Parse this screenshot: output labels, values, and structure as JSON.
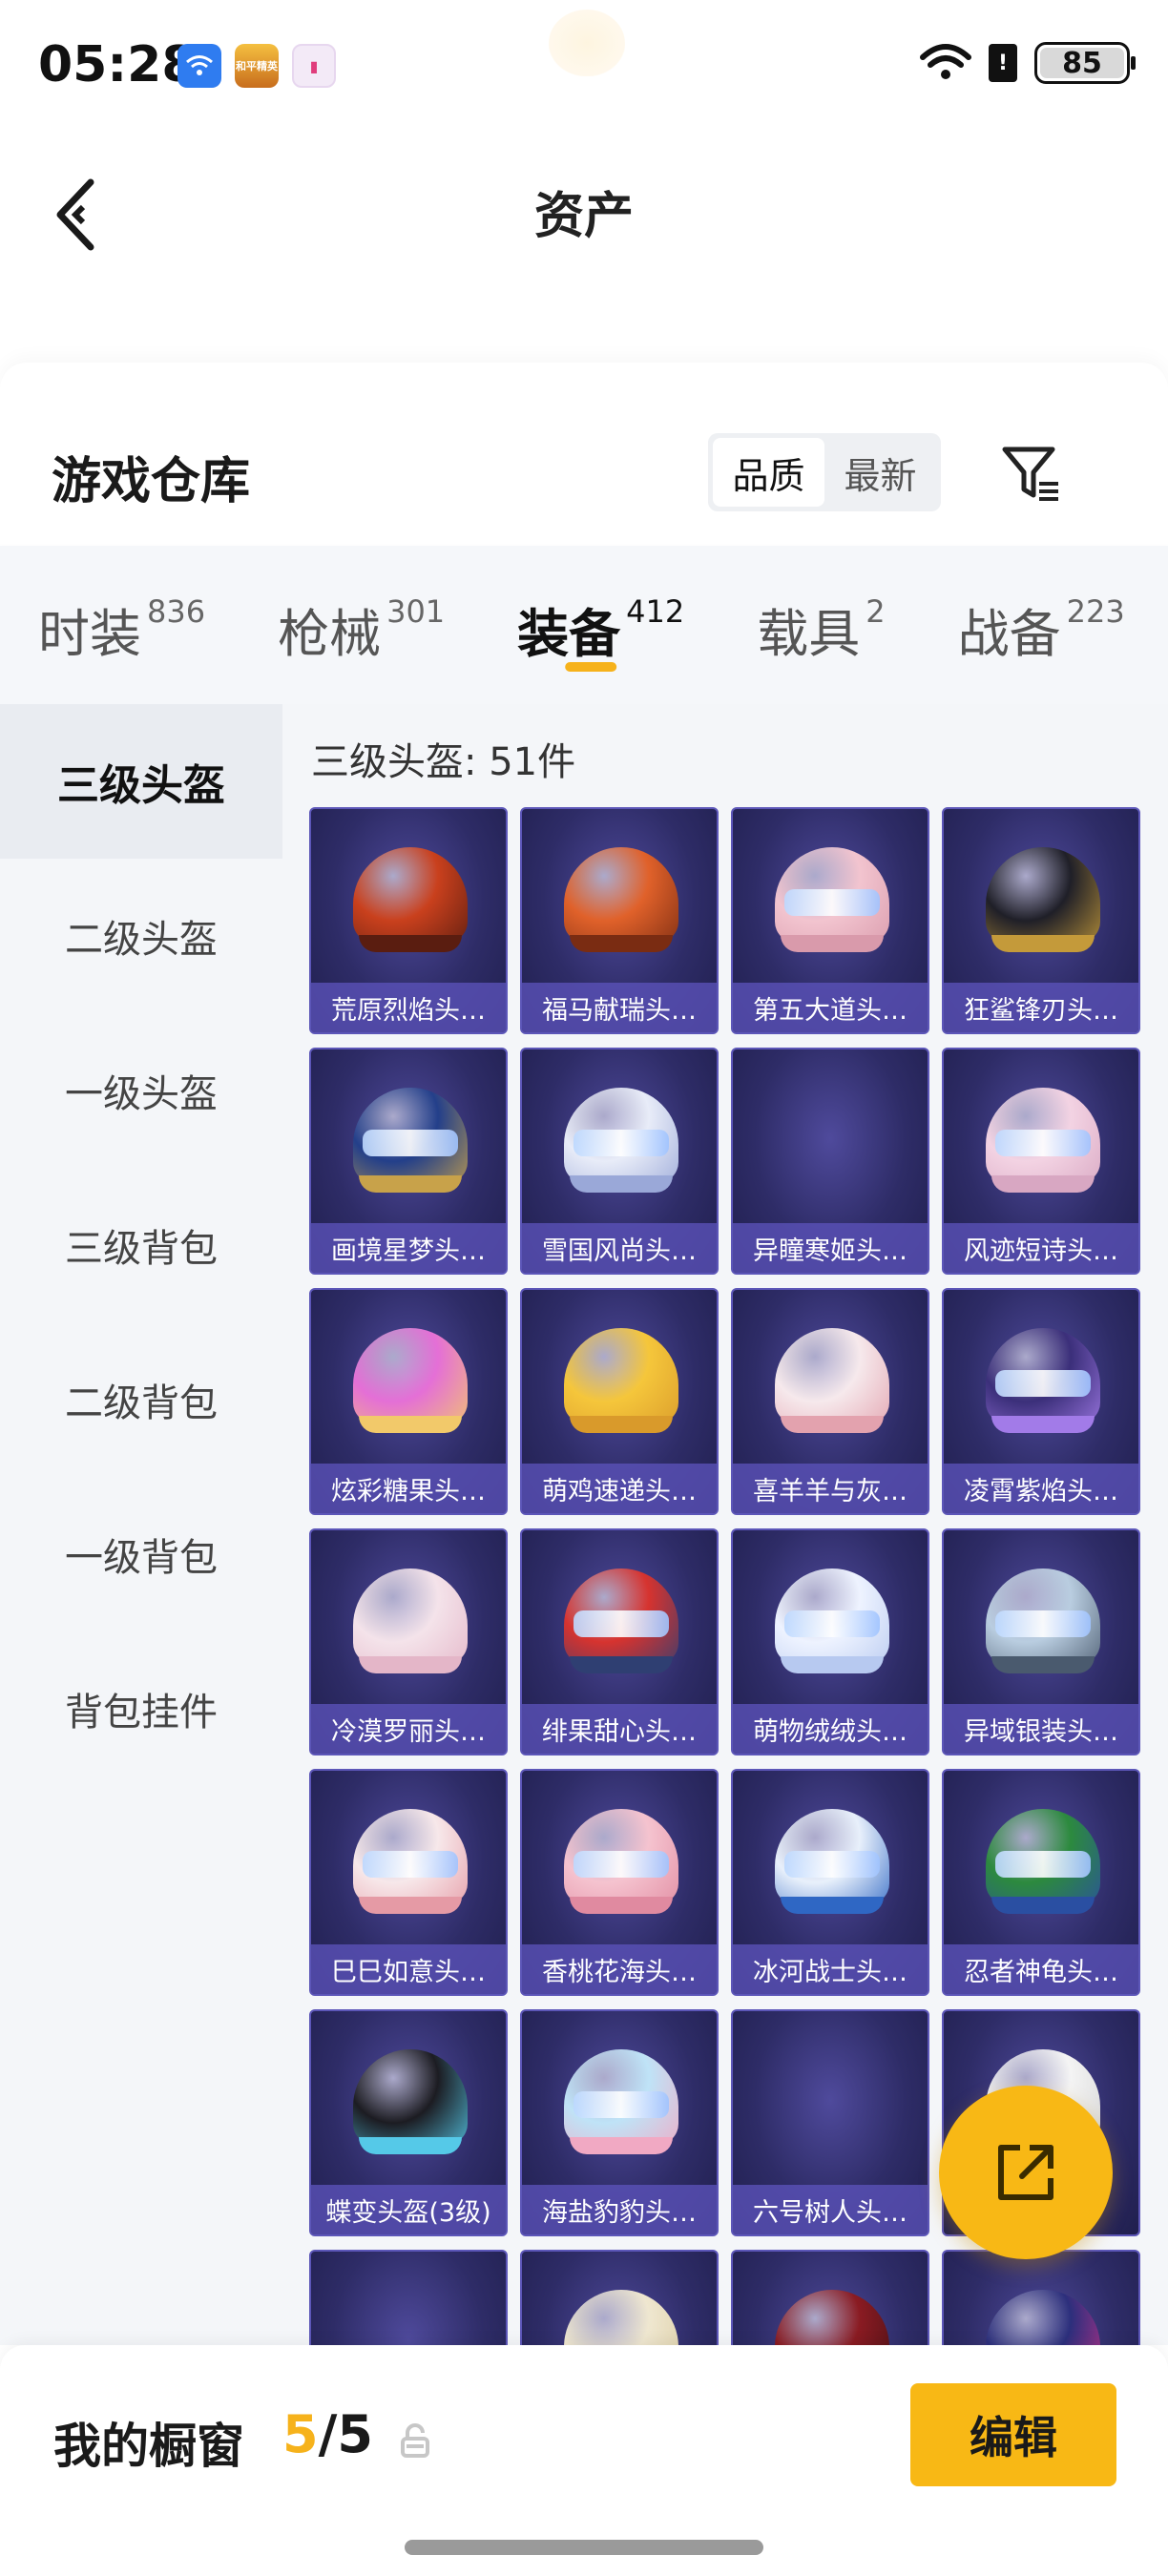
{
  "status_bar": {
    "time": "05:28",
    "battery": "85",
    "notification_icons": [
      "wifi-app-icon",
      "game-app-icon",
      "shop-app-icon"
    ],
    "game_app_icon_text": "和平精英"
  },
  "header": {
    "title": "资产"
  },
  "warehouse": {
    "title": "游戏仓库",
    "sort_options": [
      "品质",
      "最新"
    ],
    "selected_sort": "品质"
  },
  "tabs": [
    {
      "label": "时装",
      "count": "836"
    },
    {
      "label": "枪械",
      "count": "301"
    },
    {
      "label": "装备",
      "count": "412",
      "active": true
    },
    {
      "label": "载具",
      "count": "2"
    },
    {
      "label": "战备",
      "count": "223"
    }
  ],
  "sidebar": {
    "items": [
      "三级头盔",
      "二级头盔",
      "一级头盔",
      "三级背包",
      "二级背包",
      "一级背包",
      "背包挂件"
    ],
    "active": "三级头盔"
  },
  "section_title": "三级头盔: 51件",
  "items": [
    {
      "name": "荒原烈焰头…",
      "dome": "#c9401d",
      "rim": "#5a1d10",
      "visor": false
    },
    {
      "name": "福马献瑞头…",
      "dome": "#e0612a",
      "rim": "#7a2c12",
      "visor": false
    },
    {
      "name": "第五大道头…",
      "dome": "#f2c4cf",
      "rim": "#d99aab",
      "visor": true
    },
    {
      "name": "狂鲨锋刃头…",
      "dome": "#1f1f28",
      "rim": "#c49a3a",
      "visor": false
    },
    {
      "name": "画境星梦头…",
      "dome": "#233f8a",
      "rim": "#c8a24a",
      "visor": true
    },
    {
      "name": "雪国风尚头…",
      "dome": "#e8ecf8",
      "rim": "#9aa8d8",
      "visor": true
    },
    {
      "name": "异瞳寒姬头…",
      "dome": "",
      "rim": "",
      "visor": false
    },
    {
      "name": "风迹短诗头…",
      "dome": "#f3d3e3",
      "rim": "#d8a7c2",
      "visor": true
    },
    {
      "name": "炫彩糖果头…",
      "dome": "#e46fd6",
      "rim": "#f2c96a",
      "visor": false
    },
    {
      "name": "萌鸡速递头…",
      "dome": "#f5c63b",
      "rim": "#d99a2b",
      "visor": false
    },
    {
      "name": "喜羊羊与灰…",
      "dome": "#f6e9ec",
      "rim": "#e3a2ae",
      "visor": false
    },
    {
      "name": "凌霄紫焰头…",
      "dome": "#3b2f7a",
      "rim": "#a27be8",
      "visor": true
    },
    {
      "name": "冷漠罗丽头…",
      "dome": "#f4e3ea",
      "rim": "#e4b6c8",
      "visor": false
    },
    {
      "name": "绯果甜心头…",
      "dome": "#d6332f",
      "rim": "#2f3f72",
      "visor": true
    },
    {
      "name": "萌物绒绒头…",
      "dome": "#eef3ff",
      "rim": "#b7c9f0",
      "visor": true
    },
    {
      "name": "异域银装头…",
      "dome": "#b9cde0",
      "rim": "#4a5a6e",
      "visor": true
    },
    {
      "name": "巳巳如意头…",
      "dome": "#f7e8ea",
      "rim": "#e59aa5",
      "visor": true
    },
    {
      "name": "香桃花海头…",
      "dome": "#f5c3cf",
      "rim": "#e08aa0",
      "visor": true
    },
    {
      "name": "冰河战士头…",
      "dome": "#e8f0fb",
      "rim": "#2f67c4",
      "visor": true
    },
    {
      "name": "忍者神龟头…",
      "dome": "#2c8a3e",
      "rim": "#2a4fa2",
      "visor": true
    },
    {
      "name": "蝶变头盔(3级)",
      "dome": "#1c1c22",
      "rim": "#55c9e8",
      "visor": false
    },
    {
      "name": "海盐豹豹头…",
      "dome": "#bfe3f7",
      "rim": "#f1a9c3",
      "visor": true
    },
    {
      "name": "六号树人头…",
      "dome": "",
      "rim": "",
      "visor": false
    },
    {
      "name": "",
      "dome": "#f4f4f4",
      "rim": "#cfcfcf",
      "visor": false
    },
    {
      "name": "",
      "dome": "",
      "rim": "",
      "visor": false
    },
    {
      "name": "",
      "dome": "#efe7d0",
      "rim": "#d7c79a",
      "visor": false
    },
    {
      "name": "",
      "dome": "#8a1b22",
      "rim": "#3b0f14",
      "visor": false
    },
    {
      "name": "",
      "dome": "#2c2f7c",
      "rim": "#e0318c",
      "visor": false
    }
  ],
  "bottom_bar": {
    "label": "我的橱窗",
    "current": "5",
    "separator": "/",
    "total": "5",
    "edit_label": "编辑"
  },
  "colors": {
    "accent": "#f8b815",
    "card_bg": "#2e2c67",
    "card_name_bg": "#5e54be"
  }
}
